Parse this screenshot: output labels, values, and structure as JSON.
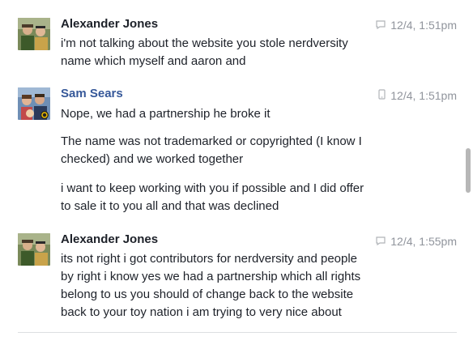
{
  "messages": [
    {
      "sender": "Alexander Jones",
      "timestamp": "12/4, 1:51pm",
      "device_icon": "chat-bubble-icon",
      "avatar": "alexander-jones-avatar",
      "lines": [
        "i'm not talking about the website you stole nerdversity",
        "name which myself and aaron and"
      ]
    },
    {
      "sender": "Sam Sears",
      "timestamp": "12/4, 1:51pm",
      "device_icon": "mobile-phone-icon",
      "avatar": "sam-sears-avatar",
      "lines": [
        "Nope, we had a partnership he broke it",
        "The name was not trademarked or copyrighted (I know I",
        "checked) and we worked together",
        "i want to keep working with you if possible and I did offer",
        "to sale it to you all and that was declined"
      ]
    },
    {
      "sender": "Alexander Jones",
      "timestamp": "12/4, 1:55pm",
      "device_icon": "chat-bubble-icon",
      "avatar": "alexander-jones-avatar",
      "lines": [
        "its not right  i got contributors for nerdversity  and people",
        "by right  i know yes we had a partnership which all rights",
        "belong to us you should of change back  to the website",
        "back to your toy nation i am trying to very  nice about"
      ]
    }
  ],
  "colors": {
    "sender_default": "#1d2129",
    "sender_highlight": "#365899",
    "meta": "#90949c",
    "scroll_thumb": "#b7b7b7"
  }
}
